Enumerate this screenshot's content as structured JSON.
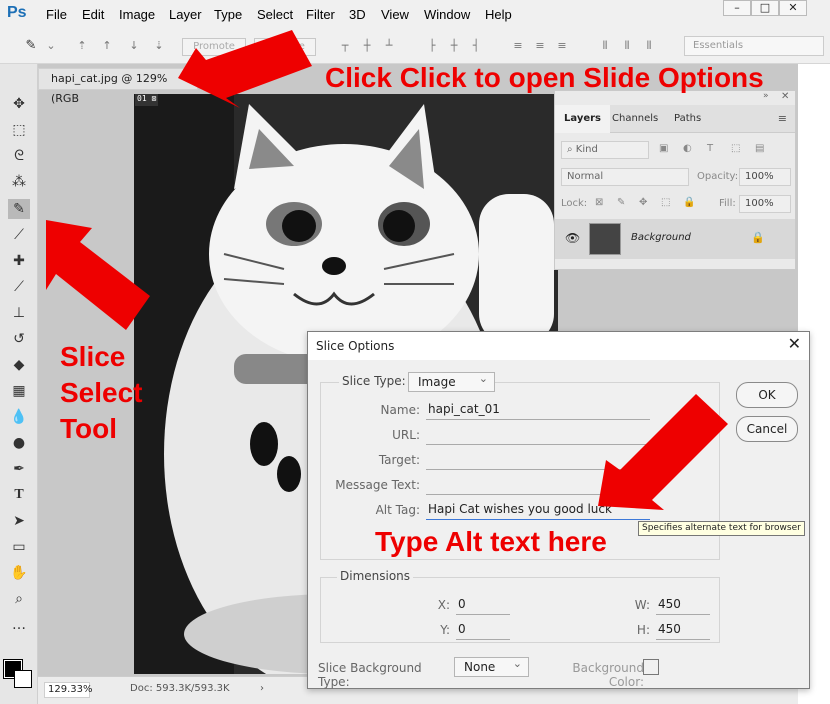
{
  "app": {
    "logo": "Ps"
  },
  "menu": [
    "File",
    "Edit",
    "Image",
    "Layer",
    "Type",
    "Select",
    "Filter",
    "3D",
    "View",
    "Window",
    "Help"
  ],
  "window_buttons": {
    "minimize": "–",
    "restore": "□",
    "close": "✕"
  },
  "options_bar": {
    "promote_label": "Promote",
    "demote_label": "Demote",
    "workspace": "Essentials"
  },
  "document": {
    "tab_title": "hapi_cat.jpg @ 129% (RGB",
    "slice_badge": "01",
    "zoom": "129.33%",
    "doc_size": "Doc: 593.3K/593.3K"
  },
  "layers_panel": {
    "tabs": [
      "Layers",
      "Channels",
      "Paths"
    ],
    "kind": "Kind",
    "blend_mode": "Normal",
    "opacity_label": "Opacity:",
    "opacity": "100%",
    "lock_label": "Lock:",
    "fill_label": "Fill:",
    "fill": "100%",
    "layer_name": "Background"
  },
  "dialog": {
    "title": "Slice Options",
    "slice_type_label": "Slice Type:",
    "slice_type": "Image",
    "name_label": "Name:",
    "name_value": "hapi_cat_01",
    "url_label": "URL:",
    "url_value": "",
    "target_label": "Target:",
    "target_value": "",
    "message_label": "Message Text:",
    "message_value": "",
    "alt_label": "Alt Tag:",
    "alt_value": "Hapi Cat wishes you good luck",
    "ok_label": "OK",
    "cancel_label": "Cancel",
    "dimensions_label": "Dimensions",
    "x_label": "X:",
    "x_value": "0",
    "y_label": "Y:",
    "y_value": "0",
    "w_label": "W:",
    "w_value": "450",
    "h_label": "H:",
    "h_value": "450",
    "bg_type_label": "Slice Background Type:",
    "bg_type": "None",
    "bg_color_label": "Background Color:"
  },
  "tooltip": "Specifies alternate text for browser",
  "annotations": {
    "top": "Click Click to open Slide Options",
    "tool_line1": "Slice",
    "tool_line2": "Select",
    "tool_line3": "Tool",
    "alt": "Type Alt text here"
  },
  "colors": {
    "annotation_red": "#ee0000",
    "ps_blue": "#1c6fb6"
  }
}
